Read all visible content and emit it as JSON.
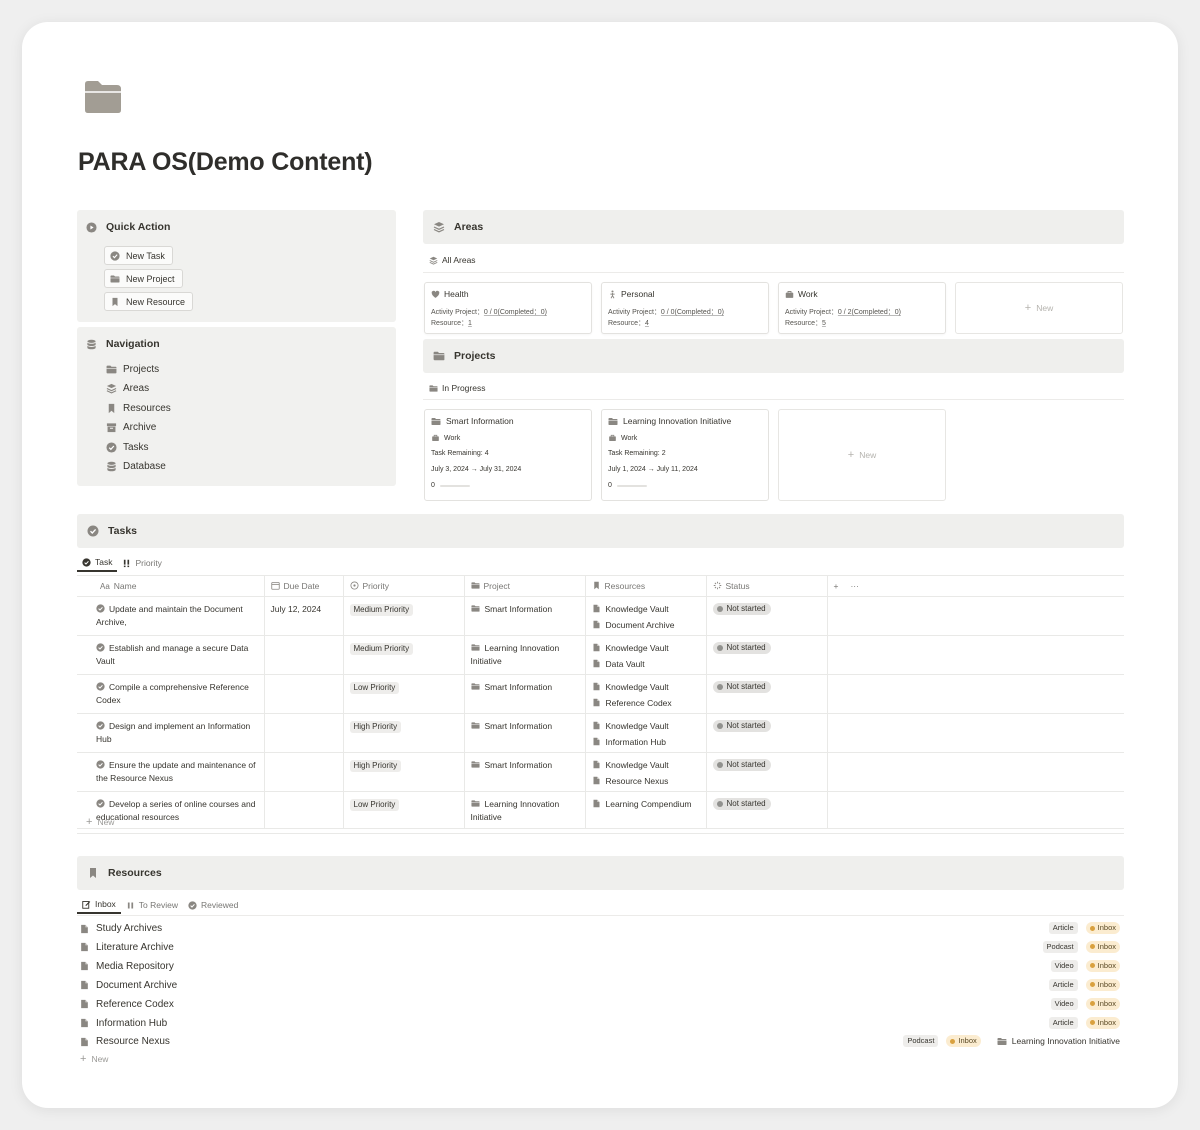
{
  "page": {
    "title": "PARA OS(Demo Content)"
  },
  "quick_action": {
    "title": "Quick Action",
    "buttons": [
      "New Task",
      "New Project",
      "New Resource"
    ]
  },
  "navigation": {
    "title": "Navigation",
    "items": [
      "Projects",
      "Areas",
      "Resources",
      "Archive",
      "Tasks",
      "Database"
    ]
  },
  "areas": {
    "title": "Areas",
    "view": "All Areas",
    "cards": [
      {
        "name": "Health",
        "activity_label": "Activity Project：",
        "activity_value": "0 / 0(Completed：0)",
        "resource_label": "Resource：",
        "resource_value": "1"
      },
      {
        "name": "Personal",
        "activity_label": "Activity Project：",
        "activity_value": "0 / 0(Completed：0)",
        "resource_label": "Resource：",
        "resource_value": "4"
      },
      {
        "name": "Work",
        "activity_label": "Activity Project：",
        "activity_value": "0 / 2(Completed：0)",
        "resource_label": "Resource：",
        "resource_value": "5"
      }
    ],
    "new_label": "New"
  },
  "projects": {
    "title": "Projects",
    "view": "In Progress",
    "cards": [
      {
        "name": "Smart Information",
        "area": "Work",
        "task_remaining": "Task Remaining: 4",
        "dates": "July 3, 2024 → July 31, 2024",
        "progress": "0"
      },
      {
        "name": "Learning Innovation Initiative",
        "area": "Work",
        "task_remaining": "Task Remaining: 2",
        "dates": "July 1, 2024 → July 11, 2024",
        "progress": "0"
      }
    ],
    "new_label": "New"
  },
  "tasks": {
    "title": "Tasks",
    "tabs": [
      "Task",
      "Priority"
    ],
    "columns": [
      "Name",
      "Due Date",
      "Priority",
      "Project",
      "Resources",
      "Status"
    ],
    "column_prefix": "Aa",
    "add_column": "+",
    "more": "···",
    "rows": [
      {
        "name": "Update and maintain the Document Archive,",
        "due": "July 12, 2024",
        "priority": "Medium Priority",
        "project": "Smart Information",
        "resources": [
          "Knowledge Vault",
          "Document Archive"
        ],
        "status": "Not started"
      },
      {
        "name": "Establish and manage a secure Data Vault",
        "due": "",
        "priority": "Medium Priority",
        "project": "Learning Innovation Initiative",
        "resources": [
          "Knowledge Vault",
          "Data Vault"
        ],
        "status": "Not started"
      },
      {
        "name": "Compile a comprehensive Reference Codex",
        "due": "",
        "priority": "Low Priority",
        "project": "Smart Information",
        "resources": [
          "Knowledge Vault",
          "Reference Codex"
        ],
        "status": "Not started"
      },
      {
        "name": "Design and implement an Information Hub",
        "due": "",
        "priority": "High Priority",
        "project": "Smart Information",
        "resources": [
          "Knowledge Vault",
          "Information Hub"
        ],
        "status": "Not started"
      },
      {
        "name": "Ensure the update and maintenance of the Resource Nexus",
        "due": "",
        "priority": "High Priority",
        "project": "Smart Information",
        "resources": [
          "Knowledge Vault",
          "Resource Nexus"
        ],
        "status": "Not started"
      },
      {
        "name": "Develop a series of online courses and educational resources",
        "due": "",
        "priority": "Low Priority",
        "project": "Learning Innovation Initiative",
        "resources": [
          "Learning Compendium"
        ],
        "status": "Not started"
      }
    ],
    "new_label": "New"
  },
  "resources": {
    "title": "Resources",
    "tabs": [
      "Inbox",
      "To Review",
      "Reviewed"
    ],
    "rows": [
      {
        "name": "Study Archives",
        "type": "Article",
        "status": "Inbox",
        "project": ""
      },
      {
        "name": "Literature Archive",
        "type": "Podcast",
        "status": "Inbox",
        "project": ""
      },
      {
        "name": "Media Repository",
        "type": "Video",
        "status": "Inbox",
        "project": ""
      },
      {
        "name": "Document Archive",
        "type": "Article",
        "status": "Inbox",
        "project": ""
      },
      {
        "name": "Reference Codex",
        "type": "Video",
        "status": "Inbox",
        "project": ""
      },
      {
        "name": "Information Hub",
        "type": "Article",
        "status": "Inbox",
        "project": ""
      },
      {
        "name": "Resource Nexus",
        "type": "Podcast",
        "status": "Inbox",
        "project": "Learning Innovation Initiative"
      }
    ],
    "new_label": "New"
  },
  "colors": {
    "accent_gray": "#91918e",
    "header_bg": "#efefed",
    "inbox_bg": "#fbecd0",
    "inbox_dot": "#d9a13f"
  }
}
